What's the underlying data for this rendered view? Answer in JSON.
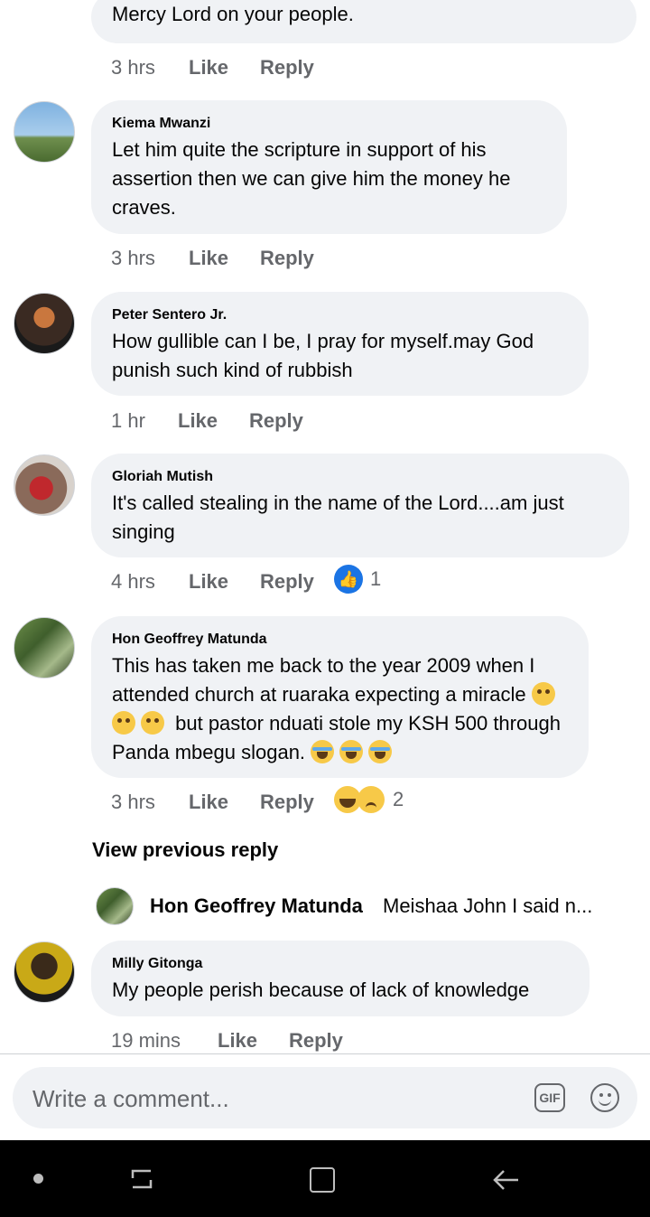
{
  "comments": [
    {
      "author": "",
      "text": "Mercy Lord on your people.",
      "time": "3 hrs",
      "like": "Like",
      "reply": "Reply"
    },
    {
      "author": "Kiema Mwanzi",
      "text": "Let him quite the scripture in support of his assertion then we can give him the money he craves.",
      "time": "3 hrs",
      "like": "Like",
      "reply": "Reply"
    },
    {
      "author": "Peter Sentero Jr.",
      "text": "How gullible can I be, I pray for myself.may God punish such kind of rubbish",
      "time": "1 hr",
      "like": "Like",
      "reply": "Reply"
    },
    {
      "author": "Gloriah Mutish",
      "text": "It's called stealing in the name of the Lord....am just singing",
      "time": "4 hrs",
      "like": "Like",
      "reply": "Reply",
      "reaction_count": "1"
    },
    {
      "author": "Hon Geoffrey Matunda",
      "text_a": "This has taken me back to the year 2009 when I attended church at ruaraka expecting a miracle",
      "text_b": "but pastor nduati stole my KSH 500 through Panda mbegu slogan.",
      "time": "3 hrs",
      "like": "Like",
      "reply": "Reply",
      "reaction_count": "2"
    },
    {
      "author": "Milly Gitonga",
      "text": "My people perish because of lack of knowledge",
      "time": "19 mins",
      "like": "Like",
      "reply": "Reply"
    }
  ],
  "view_previous_reply": "View previous reply",
  "reply_preview": {
    "author": "Hon Geoffrey Matunda",
    "text": "Meishaa John I said n..."
  },
  "composer": {
    "placeholder": "Write a comment...",
    "gif_label": "GIF"
  },
  "icons": {
    "like_reaction": "thumbs-up-icon",
    "haha_reaction": "laughing-face-icon",
    "sad_reaction": "sad-face-icon",
    "emoji": "smiley-icon"
  },
  "colors": {
    "bubble": "#f0f2f5",
    "meta": "#65676b",
    "like_blue": "#1b74e4",
    "navbar": "#000000"
  }
}
